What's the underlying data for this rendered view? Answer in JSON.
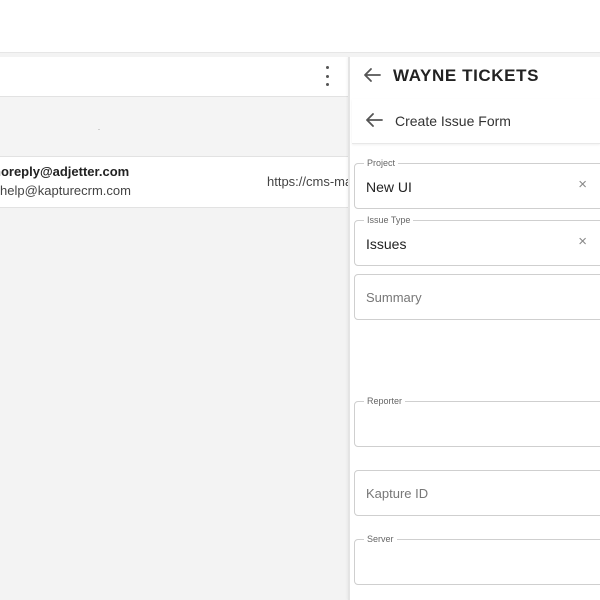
{
  "left": {
    "row": {
      "primary_email": "noreply@adjetter.com",
      "secondary_email": "help@kapturecrm.com",
      "url": "https://cms-ma"
    }
  },
  "panel": {
    "title": "WAYNE TICKETS",
    "form_title": "Create Issue Form",
    "fields": {
      "project": {
        "label": "Project",
        "value": "New UI"
      },
      "issue_type": {
        "label": "Issue Type",
        "value": "Issues"
      },
      "summary": {
        "placeholder": "Summary"
      },
      "reporter": {
        "label": "Reporter",
        "value": ""
      },
      "kapture_id": {
        "placeholder": "Kapture ID"
      },
      "server": {
        "label": "Server",
        "value": ""
      }
    },
    "clear_glyph": "×"
  },
  "icons": {
    "more": "more-vertical-icon",
    "back": "arrow-left-icon",
    "clear": "close-icon"
  }
}
